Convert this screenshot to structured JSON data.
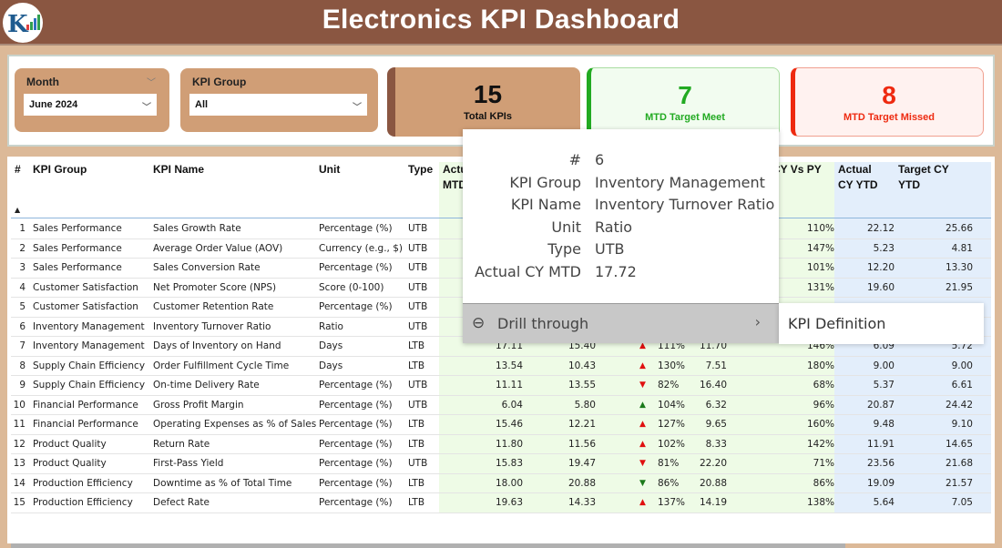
{
  "header": {
    "title": "Electronics KPI Dashboard",
    "logo_text": "K"
  },
  "filters": {
    "month_label": "Month",
    "month_value": "June 2024",
    "group_label": "KPI Group",
    "group_value": "All"
  },
  "cards": {
    "total": {
      "value": "15",
      "label": "Total KPIs"
    },
    "meet": {
      "value": "7",
      "label": "MTD Target Meet",
      "color": "#22aa22"
    },
    "missed": {
      "value": "8",
      "label": "MTD Target Missed",
      "color": "#ee2a10"
    }
  },
  "table": {
    "headers": {
      "num": "#",
      "group": "KPI Group",
      "name": "KPI Name",
      "unit": "Unit",
      "type": "Type",
      "actual_mtd": "Actual CY MTD",
      "target_mtd": "",
      "vs_target": "",
      "py_mtd": "",
      "vs_py": "Actual CY Vs PY (MTD)",
      "actual_ytd": "Actual CY YTD",
      "target_ytd": "Target CY YTD"
    },
    "sort_icon": "sort-asc-icon",
    "rows": [
      {
        "n": "1",
        "group": "Sales Performance",
        "name": "Sales Growth Rate",
        "unit": "Percentage (%)",
        "type": "UTB",
        "a": null,
        "t": null,
        "arrow": null,
        "pct": null,
        "py": null,
        "vpy": "110%",
        "ay": "22.12",
        "ty": "25.66"
      },
      {
        "n": "2",
        "group": "Sales Performance",
        "name": "Average Order Value (AOV)",
        "unit": "Currency (e.g., $)",
        "type": "UTB",
        "a": null,
        "t": null,
        "arrow": null,
        "pct": null,
        "py": null,
        "vpy": "147%",
        "ay": "5.23",
        "ty": "4.81"
      },
      {
        "n": "3",
        "group": "Sales Performance",
        "name": "Sales Conversion Rate",
        "unit": "Percentage (%)",
        "type": "UTB",
        "a": null,
        "t": null,
        "arrow": null,
        "pct": null,
        "py": null,
        "vpy": "101%",
        "ay": "12.20",
        "ty": "13.30"
      },
      {
        "n": "4",
        "group": "Customer Satisfaction",
        "name": "Net Promoter Score (NPS)",
        "unit": "Score (0-100)",
        "type": "UTB",
        "a": null,
        "t": null,
        "arrow": null,
        "pct": null,
        "py": null,
        "vpy": "131%",
        "ay": "19.60",
        "ty": "21.95"
      },
      {
        "n": "5",
        "group": "Customer Satisfaction",
        "name": "Customer Retention Rate",
        "unit": "Percentage (%)",
        "type": "UTB",
        "a": null,
        "t": null,
        "arrow": null,
        "pct": null,
        "py": null,
        "vpy": null,
        "ay": null,
        "ty": null
      },
      {
        "n": "6",
        "group": "Inventory Management",
        "name": "Inventory Turnover Ratio",
        "unit": "Ratio",
        "type": "UTB",
        "a": null,
        "t": null,
        "arrow": null,
        "pct": null,
        "py": null,
        "vpy": null,
        "ay": null,
        "ty": null
      },
      {
        "n": "7",
        "group": "Inventory Management",
        "name": "Days of Inventory on Hand",
        "unit": "Days",
        "type": "LTB",
        "a": "17.11",
        "t": "15.40",
        "arrow": "up-red",
        "pct": "111%",
        "py": "11.70",
        "vpy": "146%",
        "ay": "6.09",
        "ty": "5.72"
      },
      {
        "n": "8",
        "group": "Supply Chain Efficiency",
        "name": "Order Fulfillment Cycle Time",
        "unit": "Days",
        "type": "LTB",
        "a": "13.54",
        "t": "10.43",
        "arrow": "up-red",
        "pct": "130%",
        "py": "7.51",
        "vpy": "180%",
        "ay": "9.00",
        "ty": "9.00"
      },
      {
        "n": "9",
        "group": "Supply Chain Efficiency",
        "name": "On-time Delivery Rate",
        "unit": "Percentage (%)",
        "type": "UTB",
        "a": "11.11",
        "t": "13.55",
        "arrow": "down-red",
        "pct": "82%",
        "py": "16.40",
        "vpy": "68%",
        "ay": "5.37",
        "ty": "6.61"
      },
      {
        "n": "10",
        "group": "Financial Performance",
        "name": "Gross Profit Margin",
        "unit": "Percentage (%)",
        "type": "UTB",
        "a": "6.04",
        "t": "5.80",
        "arrow": "up-green",
        "pct": "104%",
        "py": "6.32",
        "vpy": "96%",
        "ay": "20.87",
        "ty": "24.42"
      },
      {
        "n": "11",
        "group": "Financial Performance",
        "name": "Operating Expenses as % of Sales",
        "unit": "Percentage (%)",
        "type": "LTB",
        "a": "15.46",
        "t": "12.21",
        "arrow": "up-red",
        "pct": "127%",
        "py": "9.65",
        "vpy": "160%",
        "ay": "9.48",
        "ty": "9.10"
      },
      {
        "n": "12",
        "group": "Product Quality",
        "name": "Return Rate",
        "unit": "Percentage (%)",
        "type": "LTB",
        "a": "11.80",
        "t": "11.56",
        "arrow": "up-red",
        "pct": "102%",
        "py": "8.33",
        "vpy": "142%",
        "ay": "11.91",
        "ty": "14.65"
      },
      {
        "n": "13",
        "group": "Product Quality",
        "name": "First-Pass Yield",
        "unit": "Percentage (%)",
        "type": "UTB",
        "a": "15.83",
        "t": "19.47",
        "arrow": "down-red",
        "pct": "81%",
        "py": "22.20",
        "vpy": "71%",
        "ay": "23.56",
        "ty": "21.68"
      },
      {
        "n": "14",
        "group": "Production Efficiency",
        "name": "Downtime as % of Total Time",
        "unit": "Percentage (%)",
        "type": "LTB",
        "a": "18.00",
        "t": "20.88",
        "arrow": "down-green",
        "pct": "86%",
        "py": "20.88",
        "vpy": "86%",
        "ay": "19.09",
        "ty": "21.57"
      },
      {
        "n": "15",
        "group": "Production Efficiency",
        "name": "Defect Rate",
        "unit": "Percentage (%)",
        "type": "LTB",
        "a": "19.63",
        "t": "14.33",
        "arrow": "up-red",
        "pct": "137%",
        "py": "14.19",
        "vpy": "138%",
        "ay": "5.64",
        "ty": "7.05"
      }
    ]
  },
  "tooltip": {
    "items": [
      {
        "k": "#",
        "v": "6"
      },
      {
        "k": "KPI Group",
        "v": "Inventory Management"
      },
      {
        "k": "KPI Name",
        "v": "Inventory Turnover Ratio"
      },
      {
        "k": "Unit",
        "v": "Ratio"
      },
      {
        "k": "Type",
        "v": "UTB"
      },
      {
        "k": "Actual CY MTD",
        "v": "17.72"
      }
    ],
    "drill_label": "Drill through",
    "submenu_item": "KPI Definition"
  }
}
